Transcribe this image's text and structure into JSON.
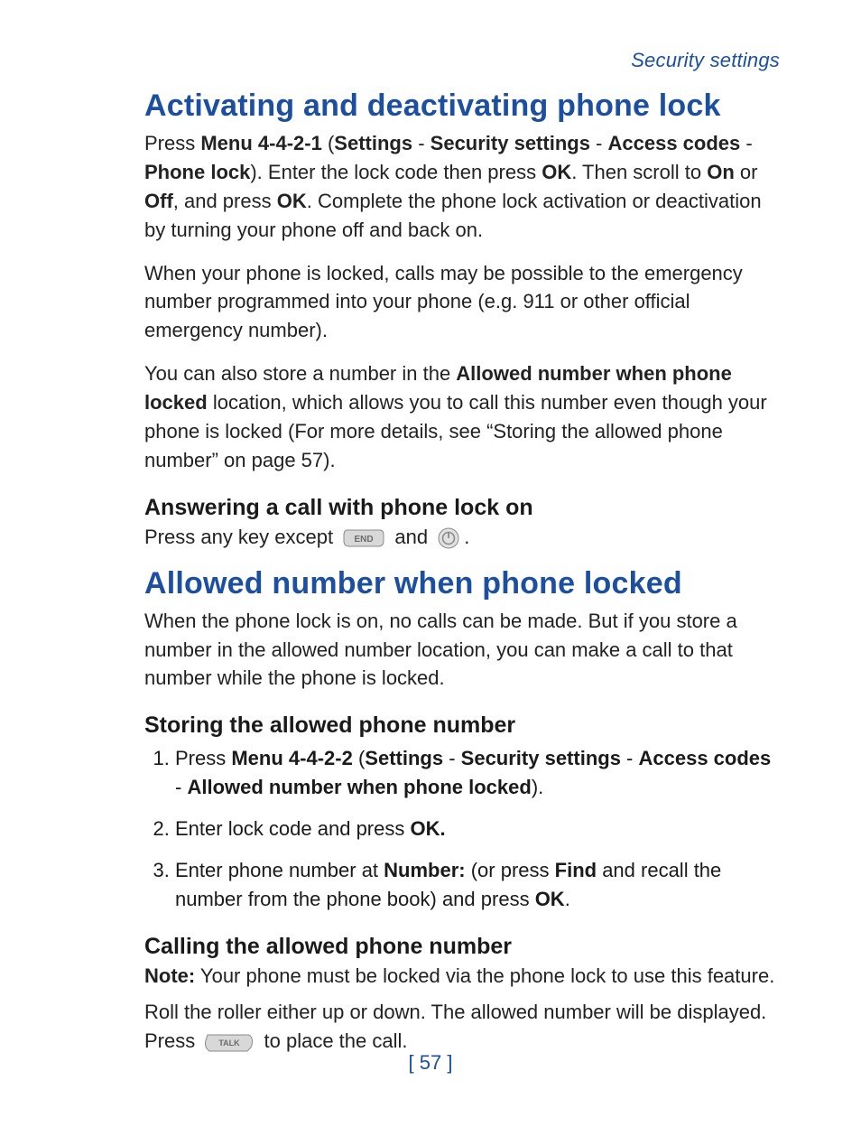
{
  "header": {
    "section": "Security settings"
  },
  "h1a": "Activating and deactivating phone lock",
  "p1": {
    "t1": "Press ",
    "b1": "Menu 4-4-2-1",
    "t2": " (",
    "b2": "Settings",
    "t3": " - ",
    "b3": "Security settings",
    "t4": " - ",
    "b4": "Access codes",
    "t5": " - ",
    "b5": "Phone lock",
    "t6": "). Enter the lock code then press ",
    "b6": "OK",
    "t7": ". Then scroll to ",
    "b7": "On",
    "t8": " or ",
    "b8": "Off",
    "t9": ", and press ",
    "b9": "OK",
    "t10": ". Complete the phone lock activation or deactivation by turning your phone off and back on."
  },
  "p2": "When your phone is locked, calls may be possible to the emergency number programmed into your phone (e.g. 911 or other official emergency number).",
  "p3": {
    "t1": "You can also store a number in the ",
    "b1": "Allowed number when phone locked",
    "t2": " location, which allows you to call this number even though your phone is locked (For more details, see “Storing the allowed phone number” on page 57)."
  },
  "h2a": "Answering a call with phone lock on",
  "p4": {
    "t1": "Press any key except",
    "t2": "and",
    "t3": "."
  },
  "h1b": "Allowed number when phone locked",
  "p5": "When the phone lock is on, no calls can be made. But if you store a number in the allowed number location, you can make a call to that number while the phone is locked.",
  "h2b": "Storing the allowed phone number",
  "steps": {
    "s1": {
      "t1": "Press ",
      "b1": "Menu 4-4-2-2",
      "t2": " (",
      "b2": "Settings",
      "t3": " - ",
      "b3": "Security settings",
      "t4": " - ",
      "b4": "Access codes",
      "t5": " - ",
      "b5": "Allowed number when phone locked",
      "t6": ")."
    },
    "s2": {
      "t1": "Enter lock code and press ",
      "b1": "OK."
    },
    "s3": {
      "t1": "Enter phone number at ",
      "b1": "Number:",
      "t2": " (or press ",
      "b2": "Find",
      "t3": " and recall the number from the phone book) and press ",
      "b3": "OK",
      "t4": "."
    }
  },
  "h2c": "Calling the allowed phone number",
  "p6": {
    "b1": "Note:",
    "t1": "  Your phone must be locked via the phone lock to use this feature."
  },
  "p7": {
    "t1": "Roll the roller either up or down. The allowed number will be displayed. Press",
    "t2": "to place the call."
  },
  "pageNo": "[ 57 ]",
  "icons": {
    "end": "END",
    "power": "power",
    "talk": "TALK"
  }
}
